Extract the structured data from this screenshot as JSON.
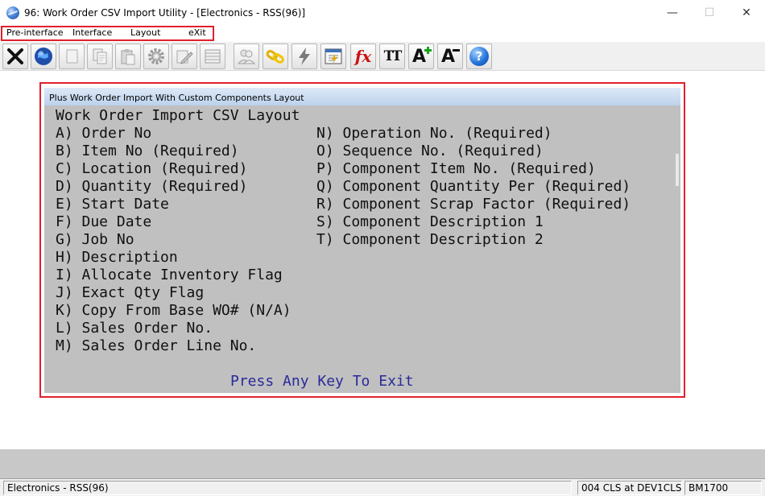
{
  "window": {
    "title": "96: Work Order CSV Import Utility - [Electronics - RSS(96)]",
    "controls": {
      "minimize": "—",
      "maximize": "☐",
      "close": "✕"
    }
  },
  "menu": {
    "items": [
      {
        "label": "Pre-interface"
      },
      {
        "label": "Interface"
      },
      {
        "label": "Layout"
      },
      {
        "label": "eXit"
      }
    ]
  },
  "toolbar": {
    "buttons": [
      {
        "icon": "close-x-icon"
      },
      {
        "icon": "globe-icon"
      },
      {
        "icon": "blank-page-icon"
      },
      {
        "icon": "copy-icon"
      },
      {
        "icon": "paste-icon"
      },
      {
        "icon": "gear-icon"
      },
      {
        "icon": "edit-icon"
      },
      {
        "icon": "table-icon"
      },
      {
        "icon": "users-icon"
      },
      {
        "icon": "link-icon"
      },
      {
        "icon": "lightning-icon"
      },
      {
        "icon": "calculator-icon"
      },
      {
        "icon": "fx-icon"
      },
      {
        "icon": "font-size-icon"
      },
      {
        "icon": "increase-font-icon"
      },
      {
        "icon": "decrease-font-icon"
      },
      {
        "icon": "help-icon"
      }
    ],
    "glyphs": {
      "fx": "fx",
      "tt": "TT",
      "a_plus": "A",
      "a_minus": "A",
      "help": "?"
    },
    "colors": {
      "red": "#cc1111",
      "green": "#1aa31a",
      "blue": "#1f6fd6",
      "globe": "#1f4fa8",
      "bolt": "#7a7a7a"
    }
  },
  "dialog": {
    "title": "Plus Work Order Import With Custom Components Layout",
    "heading": "Work Order Import CSV Layout",
    "left_fields": [
      "A) Order No",
      "B) Item No (Required)",
      "C) Location (Required)",
      "D) Quantity (Required)",
      "E) Start Date",
      "F) Due Date",
      "G) Job No",
      "H) Description",
      "I) Allocate Inventory Flag",
      "J) Exact Qty Flag",
      "K) Copy From Base WO# (N/A)",
      "L) Sales Order No.",
      "M) Sales Order Line No."
    ],
    "right_fields": [
      "N) Operation No. (Required)",
      "O) Sequence No. (Required)",
      "P) Component Item No. (Required)",
      "Q) Component Quantity Per (Required)",
      "R) Component Scrap Factor (Required)",
      "S) Component Description 1",
      "T) Component Description 2"
    ],
    "prompt": "Press Any Key To Exit"
  },
  "status": {
    "company": "Electronics - RSS(96)",
    "session": "004 CLS at DEV1CLS",
    "program": "BM1700"
  },
  "colors": {
    "highlight_outline": "#e0202c",
    "terminal_bg": "#c0c0c0",
    "prompt_text": "#2a2a9a"
  }
}
